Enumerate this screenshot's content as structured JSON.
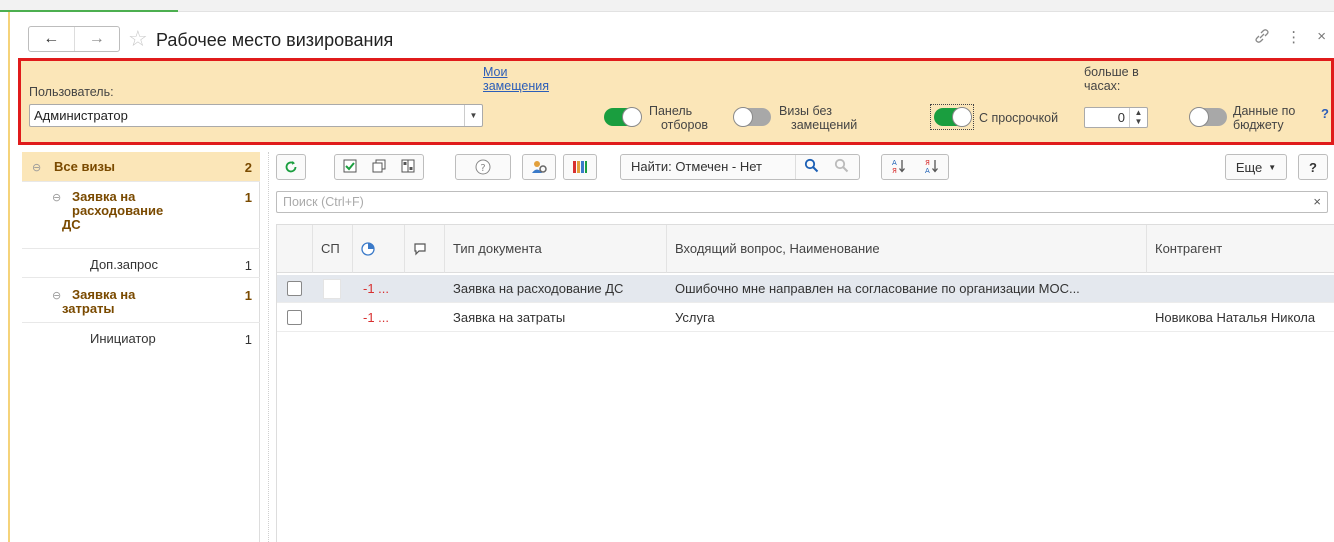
{
  "window": {
    "title": "Рабочее место визирования",
    "back_icon": "←",
    "fwd_icon": "→",
    "star_icon": "☆",
    "link_icon": "🔗",
    "more_icon": "⋮",
    "close_icon": "×"
  },
  "filter": {
    "user_label": "Пользователь:",
    "user_value": "Администратор",
    "my_replacements_link_line1": "Мои",
    "my_replacements_link_line2": "замещения",
    "toggle_panel_line1": "Панель",
    "toggle_panel_line2": "отборов",
    "toggle_panel_on": true,
    "toggle_visas_line1": "Визы без",
    "toggle_visas_line2": "замещений",
    "toggle_visas_on": false,
    "toggle_overdue": "С просрочкой",
    "toggle_overdue_on": true,
    "hours_label_line1": "больше в",
    "hours_label_line2": "часах:",
    "hours_value": "0",
    "toggle_budget_line1": "Данные по",
    "toggle_budget_line2": "бюджету",
    "toggle_budget_on": false,
    "help": "?"
  },
  "tree": [
    {
      "label": "Все визы",
      "count": "2",
      "level": 0,
      "bold": true,
      "selected": true
    },
    {
      "label_lines": [
        "Заявка на",
        "расходование",
        "ДС"
      ],
      "count": "1",
      "level": 1,
      "bold": true
    },
    {
      "label": "Доп.запрос",
      "count": "1",
      "level": 2,
      "bold": false
    },
    {
      "label_lines": [
        "Заявка на",
        "затраты"
      ],
      "count": "1",
      "level": 1,
      "bold": true
    },
    {
      "label": "Инициатор",
      "count": "1",
      "level": 2,
      "bold": false
    }
  ],
  "toolbar": {
    "find_label": "Найти: Отмечен - Нет",
    "more_label": "Еще",
    "help_label": "?"
  },
  "search": {
    "placeholder": "Поиск (Ctrl+F)"
  },
  "table": {
    "headers": [
      "СП",
      "Тип документа",
      "Входящий вопрос, Наименование",
      "Контрагент"
    ],
    "rows": [
      {
        "days": "-1 ...",
        "doc_type": "Заявка на расходование ДС",
        "question": "Ошибочно  мне направлен на согласование по организации МОС...",
        "counterparty": ""
      },
      {
        "days": "-1 ...",
        "doc_type": "Заявка на затраты",
        "question": "Услуга",
        "counterparty": "Новикова Наталья Никола"
      }
    ]
  },
  "colors": {
    "accent_panel": "#fbe6b8",
    "highlight_border": "#e01b1b",
    "toggle_on": "#1a9e3f",
    "toggle_off": "#a8a8a8",
    "overdue_text": "#d83030"
  }
}
